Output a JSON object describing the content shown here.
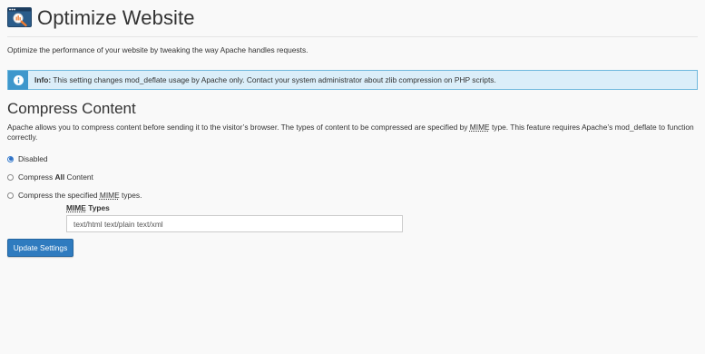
{
  "header": {
    "title": "Optimize Website",
    "icon": "magnifier-window-icon"
  },
  "description": "Optimize the performance of your website by tweaking the way Apache handles requests.",
  "alert": {
    "icon": "info-icon",
    "label": "Info:",
    "text": " This setting changes mod_deflate usage by Apache only. Contact your system administrator about zlib compression on PHP scripts.",
    "color": "#dbeef9",
    "accent": "#3e97cc"
  },
  "compress": {
    "title": "Compress Content",
    "desc_part1": "Apache allows you to compress content before sending it to the visitor’s browser. The types of content to be compressed are specified by ",
    "desc_abbr": "MIME",
    "desc_part2": " type. This feature requires Apache’s mod_deflate to function correctly.",
    "options": [
      {
        "label": "Disabled",
        "checked": true
      },
      {
        "label_pre": "Compress ",
        "label_bold": "All",
        "label_post": " Content",
        "checked": false
      },
      {
        "label_pre": "Compress the specified ",
        "label_abbr": "MIME",
        "label_post": " types.",
        "checked": false
      }
    ],
    "mime_label_abbr": "MIME",
    "mime_label_post": " Types",
    "mime_value": "text/html text/plain text/xml"
  },
  "actions": {
    "update_label": "Update Settings",
    "button_color": "#2f7bbf"
  }
}
